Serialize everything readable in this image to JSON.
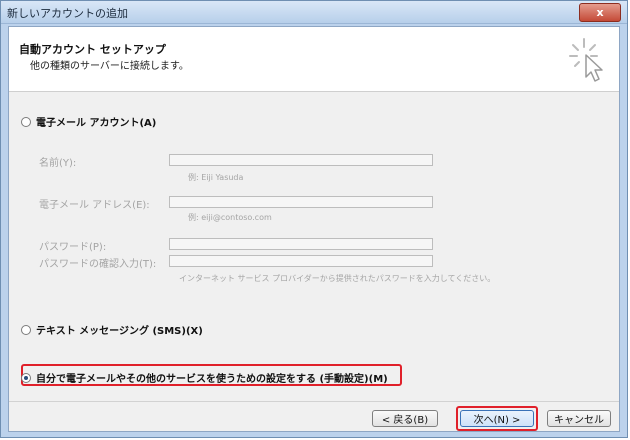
{
  "window": {
    "title": "新しいアカウントの追加",
    "close_label": "x"
  },
  "header": {
    "title": "自動アカウント セットアップ",
    "subtitle": "他の種類のサーバーに接続します。",
    "icon": "wizard-sparkle-cursor-icon"
  },
  "options": {
    "email_account": {
      "label": "電子メール アカウント(A)",
      "selected": false
    },
    "sms": {
      "label": "テキスト メッセージング (SMS)(X)",
      "selected": false
    },
    "manual": {
      "label": "自分で電子メールやその他のサービスを使うための設定をする (手動設定)(M)",
      "selected": true
    }
  },
  "form": {
    "name_label": "名前(Y):",
    "name_value": "",
    "name_hint": "例: Eiji Yasuda",
    "email_label": "電子メール アドレス(E):",
    "email_value": "",
    "email_hint": "例: eiji@contoso.com",
    "password_label": "パスワード(P):",
    "password_value": "",
    "password_confirm_label": "パスワードの確認入力(T):",
    "password_confirm_value": "",
    "password_hint": "インターネット サービス プロバイダーから提供されたパスワードを入力してください。"
  },
  "buttons": {
    "back": "< 戻る(B)",
    "next": "次へ(N) >",
    "cancel": "キャンセル"
  },
  "colors": {
    "highlight": "#e0202a",
    "title_gradient_top": "#d9e7f7",
    "close_button": "#c44a37"
  }
}
